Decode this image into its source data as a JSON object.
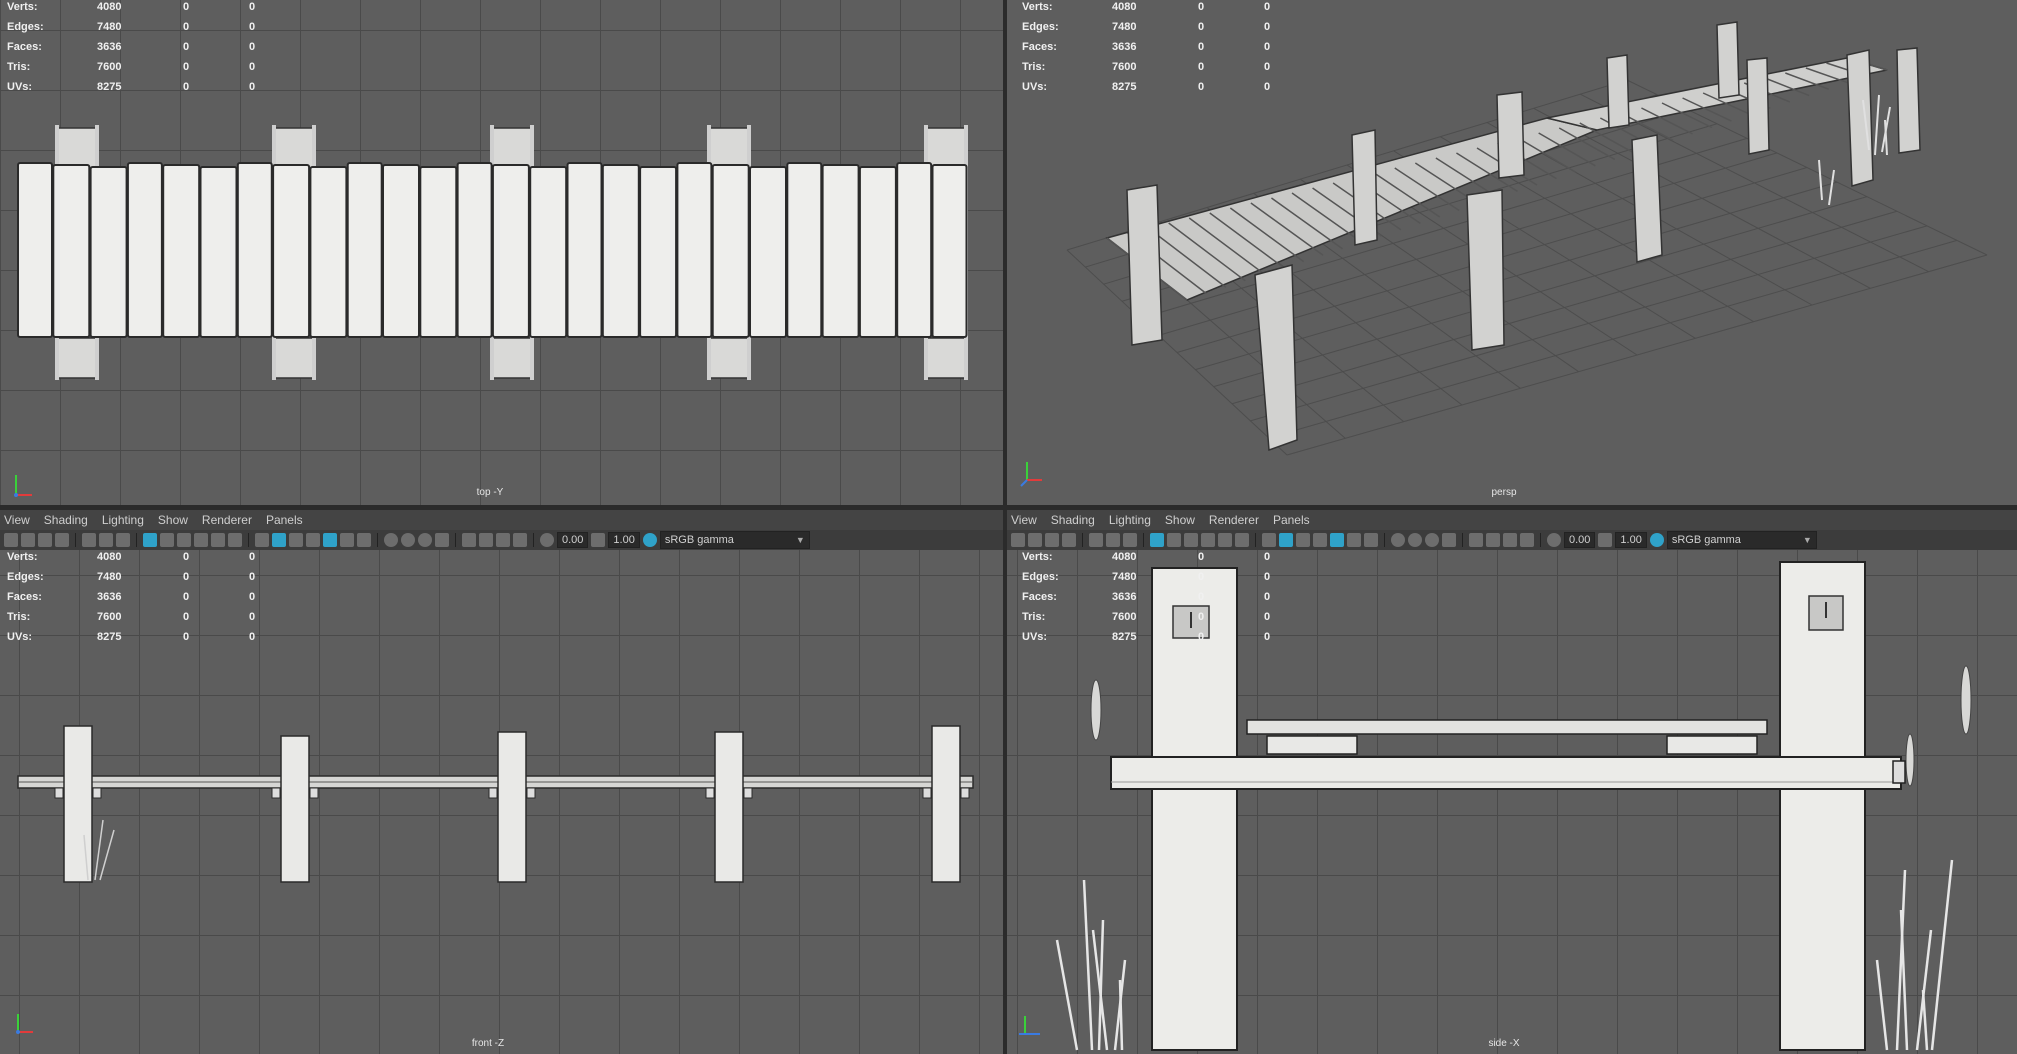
{
  "hud": {
    "rows": [
      {
        "label": "Verts:",
        "v1": "4080",
        "v2": "0",
        "v3": "0"
      },
      {
        "label": "Edges:",
        "v1": "7480",
        "v2": "0",
        "v3": "0"
      },
      {
        "label": "Faces:",
        "v1": "3636",
        "v2": "0",
        "v3": "0"
      },
      {
        "label": "Tris:",
        "v1": "7600",
        "v2": "0",
        "v3": "0"
      },
      {
        "label": "UVs:",
        "v1": "8275",
        "v2": "0",
        "v3": "0"
      }
    ]
  },
  "viewports": {
    "top": {
      "camera": "top -Y"
    },
    "persp": {
      "camera": "persp"
    },
    "front": {
      "camera": "front -Z"
    },
    "side": {
      "camera": "side -X"
    }
  },
  "panel_menu": [
    "View",
    "Shading",
    "Lighting",
    "Show",
    "Renderer",
    "Panels"
  ],
  "toolbar": {
    "exposure": "0.00",
    "gamma": "1.00",
    "color_space": "sRGB gamma"
  },
  "colors": {
    "viewport_bg": "#5e5e5e",
    "grid": "#4a4a4a",
    "highlight": "#2fa2c9",
    "wood": "#e8e8e6"
  }
}
